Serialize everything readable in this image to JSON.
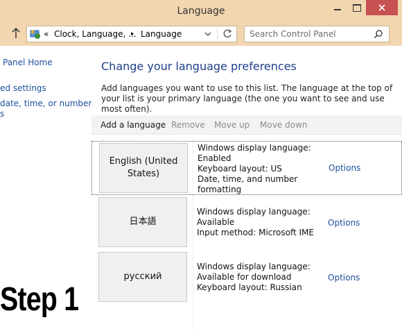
{
  "window": {
    "title": "Language"
  },
  "address": {
    "breadcrumb": [
      "«",
      "Clock, Language, ...",
      "▸",
      "Language"
    ],
    "search_placeholder": "Search Control Panel"
  },
  "left_nav": {
    "links": [
      "Panel Home",
      "ed settings",
      "date, time, or number",
      "s"
    ]
  },
  "main": {
    "heading": "Change your language preferences",
    "description": "Add languages you want to use to this list. The language at the top of your list is your primary language (the one you want to see and use most often).",
    "toolbar": [
      "Add a language",
      "Remove",
      "Move up",
      "Move down"
    ],
    "languages": [
      {
        "name": "English (United States)",
        "lines": [
          "Windows display language:",
          "Enabled",
          "Keyboard layout: US",
          "Date, time, and number",
          "formatting"
        ],
        "options": "Options"
      },
      {
        "name": "日本語",
        "lines": [
          "Windows display language:",
          "Available",
          "Input method: Microsoft IME"
        ],
        "options": "Options"
      },
      {
        "name": "русский",
        "lines": [
          "Windows display language:",
          "Available for download",
          "Keyboard layout: Russian"
        ],
        "options": "Options"
      }
    ]
  },
  "overlay": {
    "step_label": "Step 1"
  },
  "colors": {
    "titlebar": "#f2d6b0",
    "close": "#c75050",
    "link": "#1e4f9c",
    "heading": "#1e3f8a"
  },
  "icons": [
    "minimize-icon",
    "maximize-icon",
    "close-icon",
    "up-arrow-icon",
    "control-panel-icon",
    "chevron-down-icon",
    "refresh-icon",
    "search-icon"
  ]
}
